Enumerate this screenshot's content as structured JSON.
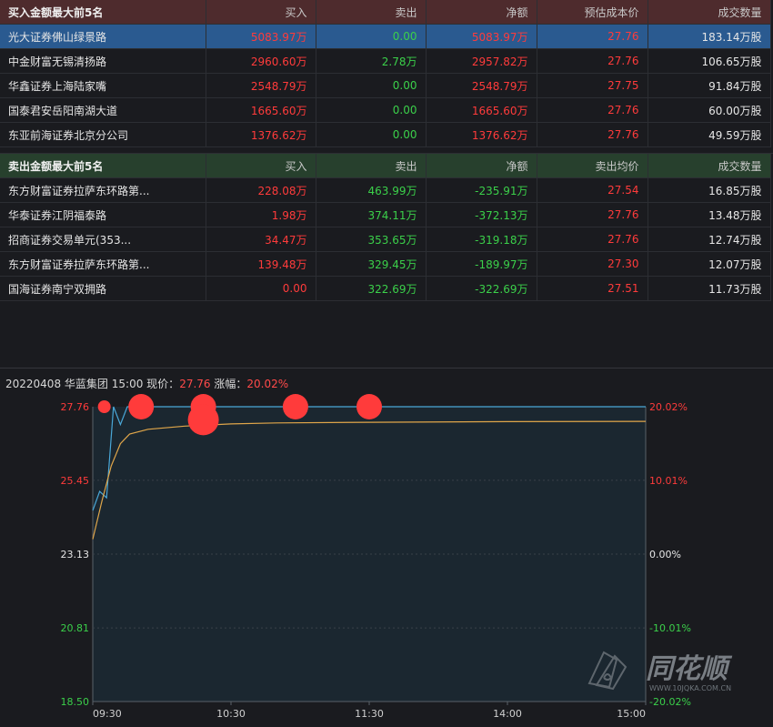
{
  "buy_table": {
    "headers": {
      "name": "买入金额最大前5名",
      "buy": "买入",
      "sell": "卖出",
      "net": "净额",
      "price": "预估成本价",
      "volume": "成交数量"
    },
    "rows": [
      {
        "name": "光大证券佛山绿景路",
        "buy": "5083.97万",
        "sell": "0.00",
        "net": "5083.97万",
        "price": "27.76",
        "volume": "183.14万股"
      },
      {
        "name": "中金财富无锡清扬路",
        "buy": "2960.60万",
        "sell": "2.78万",
        "net": "2957.82万",
        "price": "27.76",
        "volume": "106.65万股"
      },
      {
        "name": "华鑫证券上海陆家嘴",
        "buy": "2548.79万",
        "sell": "0.00",
        "net": "2548.79万",
        "price": "27.75",
        "volume": "91.84万股"
      },
      {
        "name": "国泰君安岳阳南湖大道",
        "buy": "1665.60万",
        "sell": "0.00",
        "net": "1665.60万",
        "price": "27.76",
        "volume": "60.00万股"
      },
      {
        "name": "东亚前海证券北京分公司",
        "buy": "1376.62万",
        "sell": "0.00",
        "net": "1376.62万",
        "price": "27.76",
        "volume": "49.59万股"
      }
    ],
    "selected_row": 0
  },
  "sell_table": {
    "headers": {
      "name": "卖出金额最大前5名",
      "buy": "买入",
      "sell": "卖出",
      "net": "净额",
      "price": "卖出均价",
      "volume": "成交数量"
    },
    "rows": [
      {
        "name": "东方财富证券拉萨东环路第...",
        "buy": "228.08万",
        "sell": "463.99万",
        "net": "-235.91万",
        "price": "27.54",
        "volume": "16.85万股"
      },
      {
        "name": "华泰证券江阴福泰路",
        "buy": "1.98万",
        "sell": "374.11万",
        "net": "-372.13万",
        "price": "27.76",
        "volume": "13.48万股"
      },
      {
        "name": "招商证券交易单元(353...",
        "buy": "34.47万",
        "sell": "353.65万",
        "net": "-319.18万",
        "price": "27.76",
        "volume": "12.74万股"
      },
      {
        "name": "东方财富证券拉萨东环路第...",
        "buy": "139.48万",
        "sell": "329.45万",
        "net": "-189.97万",
        "price": "27.30",
        "volume": "12.07万股"
      },
      {
        "name": "国海证券南宁双拥路",
        "buy": "0.00",
        "sell": "322.69万",
        "net": "-322.69万",
        "price": "27.51",
        "volume": "11.73万股"
      }
    ]
  },
  "chart_info": {
    "date": "20220408",
    "stock": "华蓝集团",
    "time": "15:00",
    "price_label": "现价：",
    "price": "27.76",
    "change_label": "涨幅：",
    "change": "20.02%"
  },
  "chart_data": {
    "type": "line",
    "x_ticks": [
      "09:30",
      "10:30",
      "11:30",
      "14:00",
      "15:00"
    ],
    "y_left_ticks": [
      "27.76",
      "25.45",
      "23.13",
      "20.81",
      "18.50"
    ],
    "y_right_ticks": [
      "20.02%",
      "10.01%",
      "0.00%",
      "-10.01%",
      "-20.02%"
    ],
    "ylim": [
      18.5,
      27.76
    ],
    "series": [
      {
        "role": "price",
        "color": "#4aa8d8",
        "points": [
          [
            0,
            24.5
          ],
          [
            3,
            25.1
          ],
          [
            6,
            24.9
          ],
          [
            9,
            27.76
          ],
          [
            12,
            27.2
          ],
          [
            15,
            27.76
          ],
          [
            240,
            27.76
          ]
        ]
      },
      {
        "role": "avg",
        "color": "#e0a64a",
        "points": [
          [
            0,
            23.6
          ],
          [
            4,
            24.8
          ],
          [
            8,
            25.9
          ],
          [
            12,
            26.6
          ],
          [
            16,
            26.9
          ],
          [
            24,
            27.05
          ],
          [
            40,
            27.15
          ],
          [
            60,
            27.22
          ],
          [
            80,
            27.25
          ],
          [
            120,
            27.27
          ],
          [
            180,
            27.29
          ],
          [
            240,
            27.3
          ]
        ]
      }
    ],
    "markers": [
      {
        "minute": 5,
        "price": 27.76,
        "size": "small"
      },
      {
        "minute": 21,
        "price": 27.76,
        "size": "large"
      },
      {
        "minute": 48,
        "price": 27.76,
        "size": "large"
      },
      {
        "minute": 48,
        "price": 27.35,
        "size": "xlarge"
      },
      {
        "minute": 88,
        "price": 27.76,
        "size": "large"
      },
      {
        "minute": 120,
        "price": 27.76,
        "size": "large"
      }
    ],
    "colors": {
      "up": "#ff3b3b",
      "down": "#3bd04a",
      "flat": "#e6e6e6",
      "marker": "#ff3b3b",
      "grid": "#3a4148",
      "area": "#1b2730"
    }
  },
  "watermark": {
    "text": "同花顺",
    "url_text": "WWW.10JQKA.COM.CN"
  }
}
